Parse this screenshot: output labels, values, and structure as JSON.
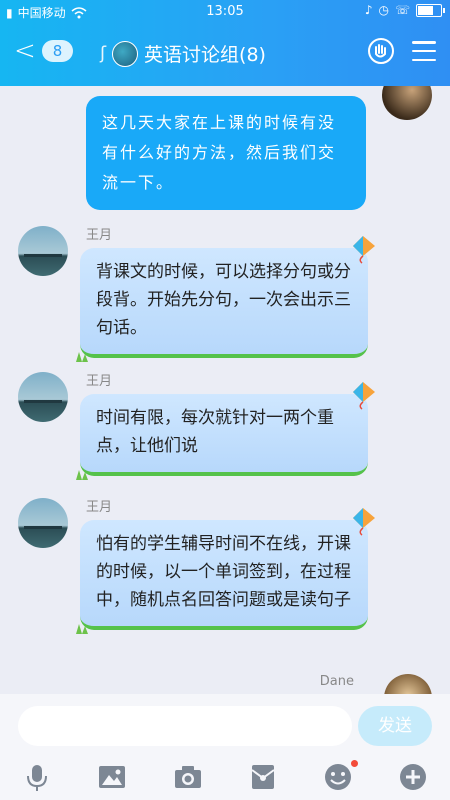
{
  "status_bar": {
    "carrier": "中国移动",
    "time": "13:05"
  },
  "nav": {
    "back_count": "8",
    "title": "英语讨论组(8)"
  },
  "messages": {
    "self_text": "这几天大家在上课的时候有没有什么好的方法，然后我们交流一下。",
    "items": [
      {
        "sender": "王月",
        "text": "背课文的时候，可以选择分句或分段背。开始先分句，一次会出示三句话。"
      },
      {
        "sender": "王月",
        "text": "时间有限，每次就针对一两个重点，让他们说"
      },
      {
        "sender": "王月",
        "text": "怕有的学生辅导时间不在线，开课的时候，以一个单词签到，在过程中，随机点名回答问题或是读句子"
      }
    ],
    "last_sender": "Dane"
  },
  "input": {
    "send_label": "发送"
  },
  "colors": {
    "header": "#2aa0f5",
    "self_bubble": "#19a9f8",
    "other_bubble": "#c4e0fd",
    "bubble_border": "#55c24a",
    "send_disabled": "#c6ebfb",
    "notify_dot": "#f34b3a"
  },
  "icons": [
    "wifi-icon",
    "alarm-icon",
    "volte-icon",
    "battery-icon",
    "back-chevron-icon",
    "ear-icon",
    "phone-hand-icon",
    "menu-icon",
    "kite-icon",
    "voice-icon",
    "image-icon",
    "camera-icon",
    "red-packet-icon",
    "emoji-icon",
    "plus-icon"
  ]
}
